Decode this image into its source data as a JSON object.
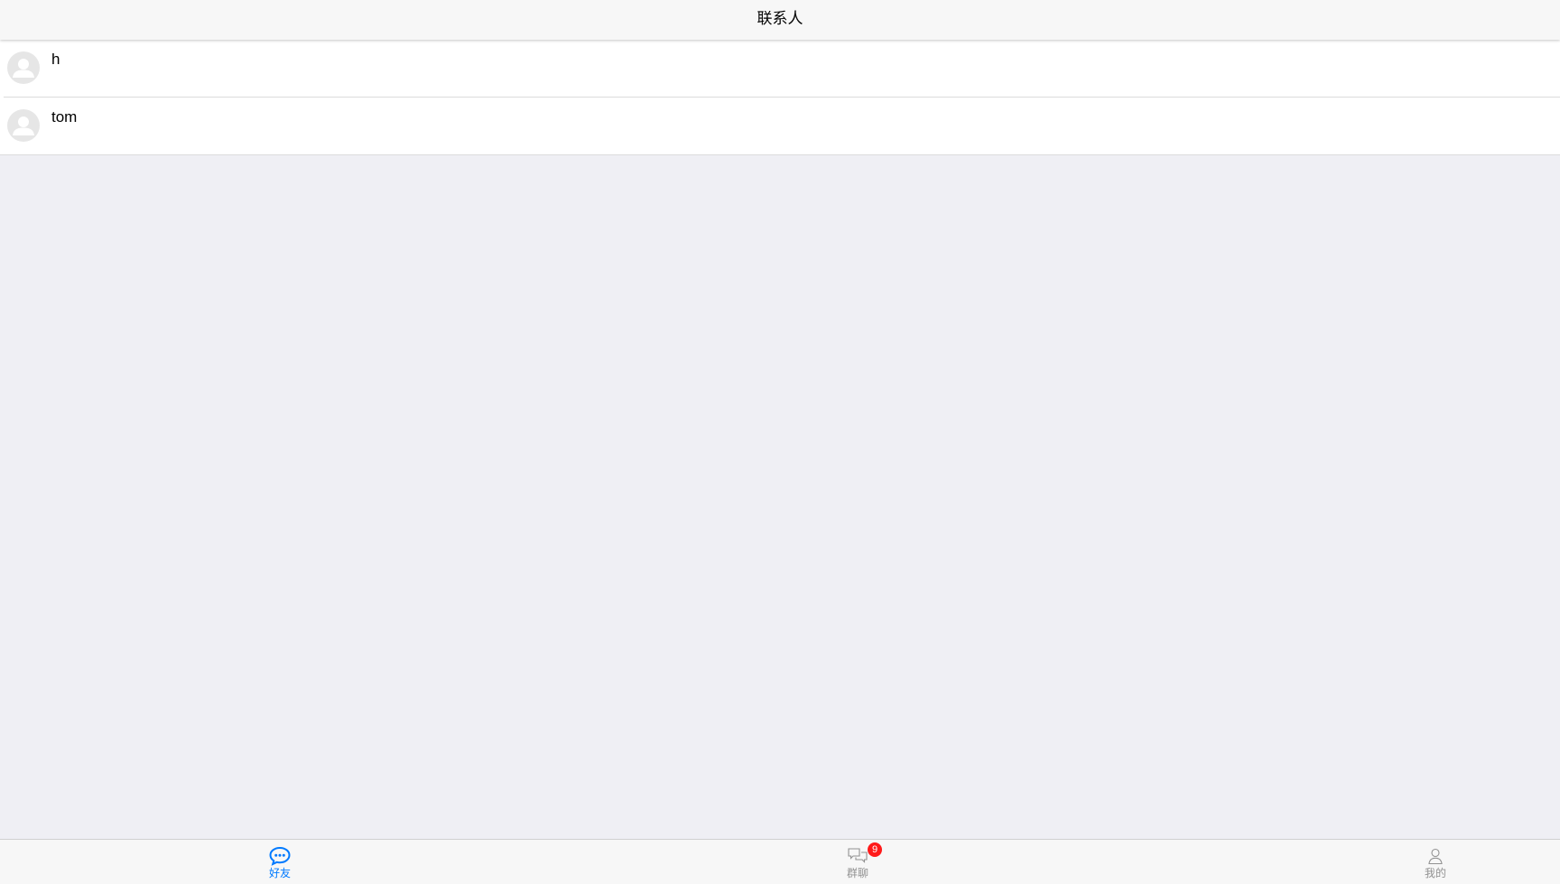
{
  "header": {
    "title": "联系人"
  },
  "contacts": [
    {
      "name": "h"
    },
    {
      "name": "tom"
    }
  ],
  "tabbar": {
    "tabs": [
      {
        "label": "好友",
        "icon": "chat-bubble-icon",
        "active": true
      },
      {
        "label": "群聊",
        "icon": "group-chat-icon",
        "badge": "9",
        "active": false
      },
      {
        "label": "我的",
        "icon": "person-icon",
        "active": false
      }
    ]
  },
  "colors": {
    "accent": "#007aff",
    "badge": "#ff1a1a",
    "background": "#efeff4",
    "inactive": "#929292"
  }
}
